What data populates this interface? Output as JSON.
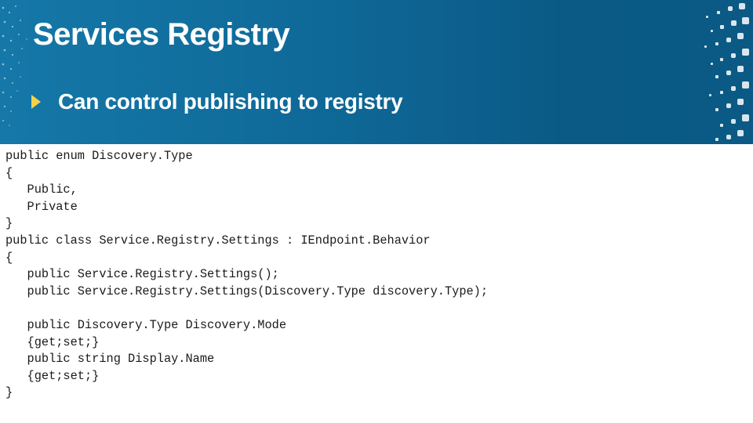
{
  "slide": {
    "title": "Services Registry",
    "bullet": "Can control publishing to registry"
  },
  "code": [
    "public enum Discovery.Type",
    "{",
    "   Public,",
    "   Private",
    "}",
    "public class Service.Registry.Settings : IEndpoint.Behavior",
    "{",
    "   public Service.Registry.Settings();",
    "   public Service.Registry.Settings(Discovery.Type discovery.Type);",
    "",
    "   public Discovery.Type Discovery.Mode",
    "   {get;set;}",
    "   public string Display.Name",
    "   {get;set;}",
    "}"
  ],
  "colors": {
    "header_background": "#0f6a99",
    "title_text": "#ffffff",
    "bullet_marker": "#f5d24a",
    "code_text": "#1a1a1a"
  }
}
